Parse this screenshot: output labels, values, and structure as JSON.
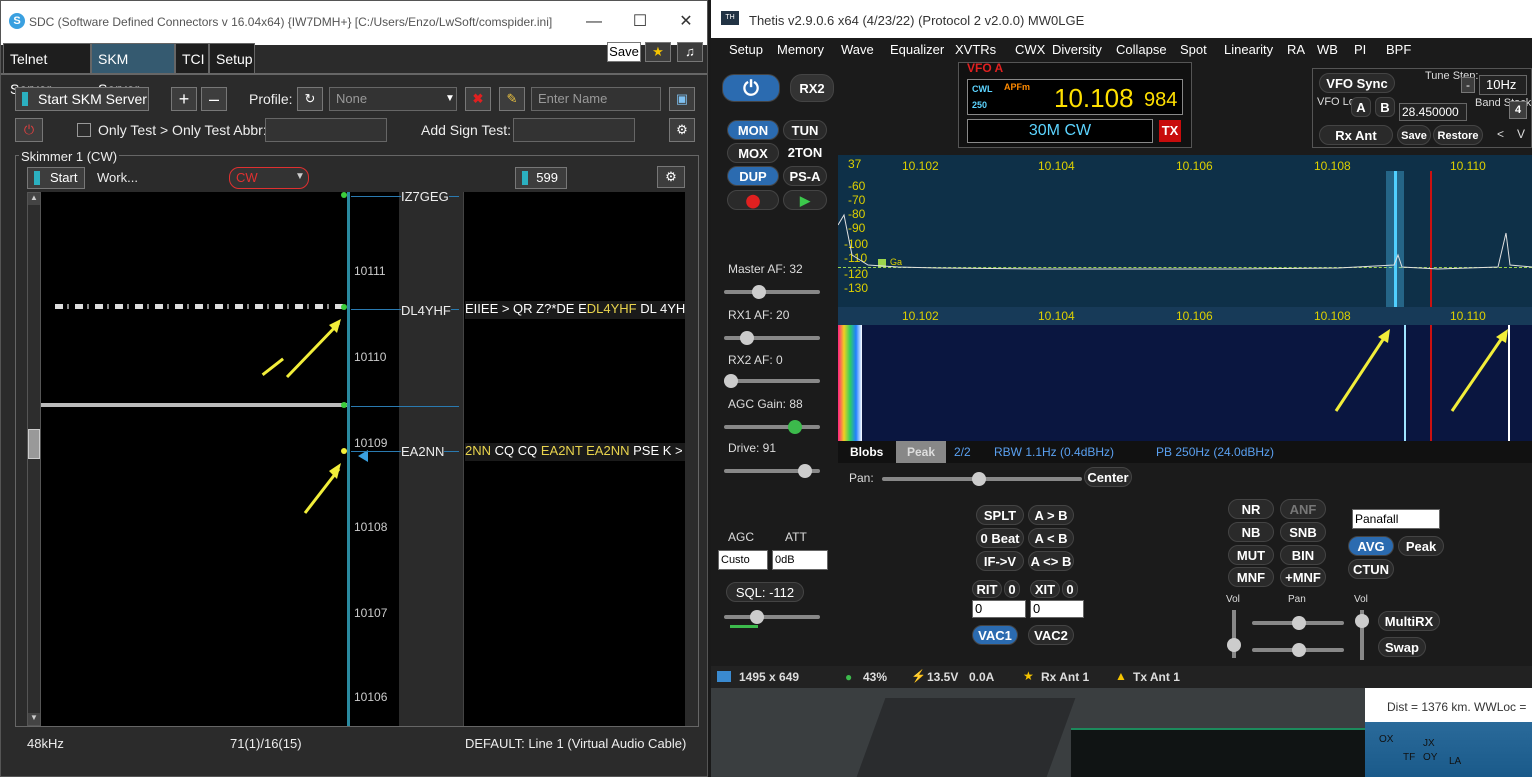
{
  "sdc": {
    "title": "SDC (Software Defined Connectors v 16.04x64) {IW7DMH+} [C:/Users/Enzo/LwSoft/comspider.ini]",
    "tabs": [
      "Telnet Server",
      "SKM Server",
      "TCI",
      "Setup"
    ],
    "save_label": "Save",
    "start_skm_label": "Start SKM Server",
    "profile_label": "Profile:",
    "profile_value": "None",
    "enter_name_placeholder": "Enter Name",
    "only_test_label": "Only Test > Only Test Abbr:",
    "add_sign_label": "Add Sign Test:",
    "group_label": "Skimmer 1 (CW)",
    "start_label": "Start",
    "status_label": "Work...",
    "mode_value": "CW",
    "wpm_value": "599",
    "scale_ticks": [
      "10111",
      "10110",
      "10109",
      "10108",
      "10107",
      "10106"
    ],
    "callsigns": [
      "IZ7GEG",
      "DL4YHF",
      "EA2NN"
    ],
    "decoded": [
      {
        "pre": "EIIEE > QR Z?*DE E",
        "hl": "DL4YHF",
        "post": " DL 4YH"
      },
      {
        "pre": "",
        "hl": "2NN",
        "post": " CQ CQ ",
        "hl2": "EA2NT EA2NN",
        "post2": " PSE K >"
      }
    ],
    "footer_left": "48kHz",
    "footer_mid": "71(1)/16(15)",
    "footer_right": "DEFAULT: Line 1 (Virtual Audio Cable)"
  },
  "thetis": {
    "title": "Thetis v2.9.0.6 x64 (4/23/22) (Protocol 2 v2.0.0) MW0LGE",
    "menu": [
      "Setup",
      "Memory",
      "Wave",
      "Equalizer",
      "XVTRs",
      "CWX",
      "Diversity",
      "Collapse",
      "Spot",
      "Linearity",
      "RA",
      "WB",
      "PI",
      "BPF"
    ],
    "rx2": "RX2",
    "buttons": {
      "mon": "MON",
      "tun": "TUN",
      "mox": "MOX",
      "ton": "2TON",
      "dup": "DUP",
      "psa": "PS-A"
    },
    "vfo_label": "VFO A",
    "vfo_mode": "CWL",
    "vfo_apf": "APFm",
    "vfo_bw": "250",
    "vfo_freq_main": "10.108",
    "vfo_freq_sub": "984",
    "band": "30M CW",
    "tx": "TX",
    "vfo_sync": "VFO Sync",
    "tune_step": "Tune Step:",
    "tune_value": "10Hz",
    "vfo_lock": "VFO Lock:",
    "a": "A",
    "b": "B",
    "lock_freq": "28.450000",
    "band_stack": "Band Stack",
    "stack_num": "4",
    "rx_ant": "Rx Ant",
    "save": "Save",
    "restore": "Restore",
    "master_af": "Master AF:  32",
    "rx1_af": "RX1 AF:  20",
    "rx2_af": "RX2 AF:  0",
    "agc_gain": "AGC Gain:  88",
    "drive": "Drive:  91",
    "spec_top": "37",
    "db_ticks": [
      "-60",
      "-70",
      "-80",
      "-90",
      "-100",
      "-110",
      "-120",
      "-130"
    ],
    "freq_ticks": [
      "10.102",
      "10.104",
      "10.106",
      "10.108",
      "10.110"
    ],
    "spot_label": "Ga",
    "blobs": "Blobs",
    "peak": "Peak",
    "page": "2/2",
    "rbw": "RBW 1.1Hz (0.4dBHz)",
    "pb": "PB 250Hz (24.0dBHz)",
    "pan": "Pan:",
    "center": "Center",
    "agc": "AGC",
    "att": "ATT",
    "agc_val": "Custo",
    "att_val": "0dB",
    "sql": "SQL: -112",
    "splt": "SPLT",
    "atob": "A > B",
    "beat": "0 Beat",
    "altb": "A < B",
    "ifv": "IF->V",
    "aswap": "A <> B",
    "rit": "RIT",
    "rit_val": "0",
    "xit": "XIT",
    "xit_val": "0",
    "rit_num": "0",
    "xit_num": "0",
    "vac1": "VAC1",
    "vac2": "VAC2",
    "nr": "NR",
    "anf": "ANF",
    "nb": "NB",
    "snb": "SNB",
    "mut": "MUT",
    "bin": "BIN",
    "mnf": "MNF",
    "pmnf": "+MNF",
    "panafall": "Panafall",
    "avg": "AVG",
    "peak2": "Peak",
    "ctun": "CTUN",
    "vol": "Vol",
    "pan2": "Pan",
    "vol2": "Vol",
    "multirx": "MultiRX",
    "swap": "Swap",
    "status_res": "1495 x 649",
    "status_cpu": "43%",
    "status_volt": "13.5V",
    "status_amp": "0.0A",
    "status_rxant": "Rx Ant 1",
    "status_txant": "Tx Ant 1",
    "map_text": "Dist = 1376 km.  WWLoc = ",
    "map_labels": [
      "OX",
      "JX",
      "OY",
      "TF",
      "LA"
    ]
  },
  "colors": {
    "accent": "#2b6bb0",
    "highlight": "#e9d44d",
    "vfo_text": "#ffe000",
    "red": "#cc1111"
  }
}
